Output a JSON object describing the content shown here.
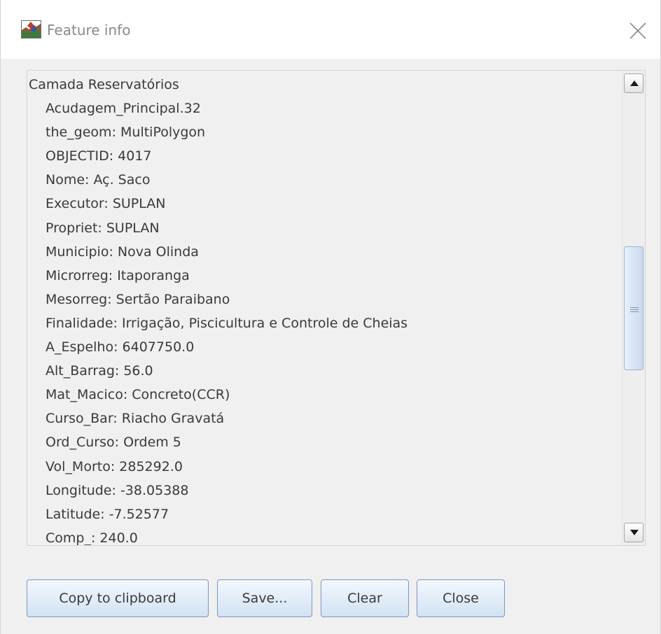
{
  "window": {
    "title": "Feature info",
    "close_icon": "close-x-icon",
    "app_icon": "app-map-icon"
  },
  "feature": {
    "header": "Camada Reservatórios",
    "lines": [
      "Acudagem_Principal.32",
      "the_geom: MultiPolygon",
      "OBJECTID: 4017",
      "Nome: Aç. Saco",
      "Executor: SUPLAN",
      "Propriet: SUPLAN",
      "Municipio: Nova Olinda",
      "Microrreg: Itaporanga",
      "Mesorreg: Sertão Paraibano",
      "Finalidade: Irrigação, Piscicultura e Controle de Cheias",
      "A_Espelho: 6407750.0",
      "Alt_Barrag: 56.0",
      "Mat_Macico: Concreto(CCR)",
      "Curso_Bar: Riacho Gravatá",
      "Ord_Curso: Ordem 5",
      "Vol_Morto: 285292.0",
      "Longitude: -38.05388",
      "Latitude: -7.52577",
      "Comp_: 240.0"
    ]
  },
  "scrollbar": {
    "position_fraction": 0.5,
    "visible_fraction": 0.29
  },
  "buttons": {
    "copy": "Copy to clipboard",
    "save": "Save...",
    "clear": "Clear",
    "close": "Close"
  }
}
